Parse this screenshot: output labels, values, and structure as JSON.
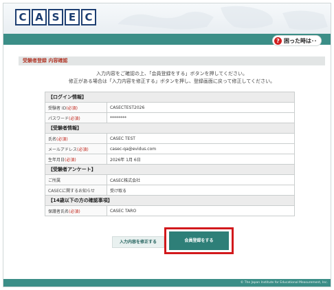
{
  "header": {
    "logo_letters": [
      "C",
      "A",
      "S",
      "E",
      "C"
    ],
    "help_label": "困った時は･･"
  },
  "section": {
    "title": "受験者登録  内容確認",
    "intro_line1": "入力内容をご確認の上、「会員登録をする」ボタンを押してください。",
    "intro_line2": "修正がある場合は「入力内容を修正する」ボタンを押し、登録画面に戻って修正してください。"
  },
  "required_mark": "(必須)",
  "table": {
    "login_header": "【ログイン情報】",
    "id_label": "受験者 ID",
    "id_value": "CASECTEST2026",
    "pw_label": "パスワード",
    "pw_value": "********",
    "person_header": "【受験者情報】",
    "name_label": "氏名",
    "name_value": "CASEC TEST",
    "email_label": "メールアドレス",
    "email_value": "casec-qa@evidus.com",
    "birth_label": "生年月日",
    "birth_value": "2026年 1月 6日",
    "survey_header": "【受験者アンケート】",
    "affiliation_label": "ご所属",
    "affiliation_value": "CASEC株式会社",
    "notice_label": "CASECに関するお知らせ",
    "notice_value": "受け取る",
    "minor_header": "【14歳以下の方の確認事項】",
    "guardian_label": "保護者氏名",
    "guardian_value": "CASEC TARO"
  },
  "buttons": {
    "edit_label": "入力内容を修正する",
    "submit_label": "会員登録をする"
  },
  "footer": {
    "copyright": "© The Japan Institute for Educational Measurement, Inc."
  },
  "colors": {
    "teal": "#3b8e87",
    "navy": "#1d3e71",
    "required_red": "#c0281e",
    "highlight_red": "#d2191c"
  }
}
